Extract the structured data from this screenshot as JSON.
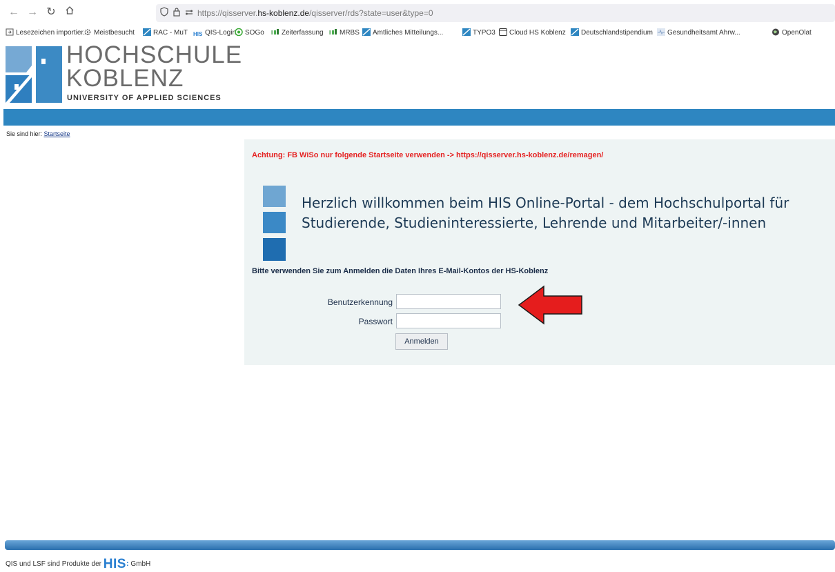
{
  "browser": {
    "url_prefix": "https://qisserver.",
    "url_domain": "hs-koblenz.de",
    "url_suffix": "/qisserver/rds?state=user&type=0",
    "bookmarks": [
      {
        "label": "Lesezeichen importier...",
        "icon": "import-icon",
        "color": "#555555"
      },
      {
        "label": "Meistbesucht",
        "icon": "gear-icon",
        "color": "#555555"
      },
      {
        "label": "RAC - MuT",
        "icon": "hs-logo-icon",
        "color": "#2e86c1"
      },
      {
        "label": "QIS-Login",
        "icon": "his-icon",
        "color": "#2a7fd0"
      },
      {
        "label": "SOGo",
        "icon": "sogo-icon",
        "color": "#3aa835"
      },
      {
        "label": "Zeiterfassung",
        "icon": "bars-icon",
        "color": "#4caf50"
      },
      {
        "label": "MRBS",
        "icon": "bars-icon",
        "color": "#4caf50"
      },
      {
        "label": "Amtliches Mitteilungs...",
        "icon": "hs-logo-icon",
        "color": "#2e86c1"
      },
      {
        "label": "TYPO3",
        "icon": "hs-logo-icon",
        "color": "#2e86c1"
      },
      {
        "label": "Cloud HS Koblenz",
        "icon": "cloud-icon",
        "color": "#333333"
      },
      {
        "label": "Deutschlandstipendium",
        "icon": "hs-logo-icon",
        "color": "#2e86c1"
      },
      {
        "label": "Gesundheitsamt Ahrw...",
        "icon": "health-icon",
        "color": "#8aa4c8"
      },
      {
        "label": "OpenOlat",
        "icon": "globe-icon",
        "color": "#333333"
      }
    ]
  },
  "logo": {
    "line1": "HOCHSCHULE",
    "line2": "KOBLENZ",
    "line3": "UNIVERSITY OF APPLIED SCIENCES"
  },
  "breadcrumb": {
    "prefix": "Sie sind hier:",
    "link": "Startseite"
  },
  "main": {
    "warning": "Achtung: FB WiSo nur folgende Startseite verwenden -> https://qisserver.hs-koblenz.de/remagen/",
    "welcome_line1": "Herzlich willkommen beim HIS Online-Portal - dem Hochschulportal für",
    "welcome_line2": "Studierende, Studieninteressierte, Lehrende und Mitarbeiter/-innen",
    "instructions": "Bitte verwenden Sie zum Anmelden die Daten Ihres E-Mail-Kontos der HS-Koblenz",
    "username_label": "Benutzerkennung",
    "password_label": "Passwort",
    "username_value": "",
    "password_value": "",
    "login_button": "Anmelden"
  },
  "footer": {
    "text": "QIS und LSF sind Produkte der",
    "his": "HIS",
    "his_mark": ":",
    "gmbh": "GmbH"
  },
  "colors": {
    "accent": "#2e86c1",
    "warning": "#e52222",
    "arrow": "#e51d1d"
  }
}
